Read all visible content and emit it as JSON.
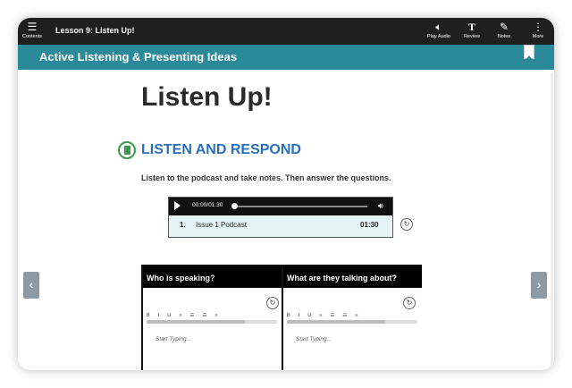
{
  "topbar": {
    "contents_label": "Contents",
    "lesson_title": "Lesson 9: Listen Up!",
    "play_audio_label": "Play Audio",
    "review_label": "Review",
    "notes_label": "Notes",
    "more_label": "More",
    "icons": {
      "menu": "menu-icon",
      "play_audio": "speaker-icon",
      "review": "text-icon",
      "notes": "edit-icon",
      "more": "more-vertical-icon"
    }
  },
  "subheader": {
    "title": "Active Listening & Presenting Ideas",
    "color": "#2b8a9a"
  },
  "page": {
    "heading": "Listen Up!",
    "section_title": "LISTEN AND RESPOND",
    "section_color": "#2a6fbe",
    "instructions": "Listen to the podcast and take notes. Then answer the questions."
  },
  "audio_player": {
    "time": "00:00/01:30",
    "progress": 0,
    "track_number": "1.",
    "track_name": "Issue 1 Podcast",
    "track_duration": "01:30"
  },
  "notes_table": {
    "columns": [
      {
        "header": "Who is speaking?",
        "placeholder": "Start Typing..."
      },
      {
        "header": "What are they talking about?",
        "placeholder": "Start Typing..."
      }
    ],
    "toolbar": [
      "B",
      "I",
      "U",
      "≡",
      "☰",
      "☰",
      "≡"
    ]
  }
}
